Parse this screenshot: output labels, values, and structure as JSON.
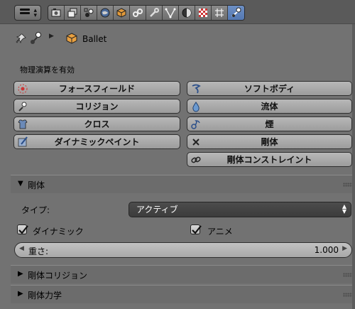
{
  "header": {
    "tabs": [
      {
        "icon": "render-icon",
        "active": false
      },
      {
        "icon": "render-layers-icon",
        "active": false
      },
      {
        "icon": "scene-icon",
        "active": false
      },
      {
        "icon": "world-icon",
        "active": false
      },
      {
        "icon": "object-icon",
        "active": false
      },
      {
        "icon": "constraints-icon",
        "active": false
      },
      {
        "icon": "modifiers-icon",
        "active": false
      },
      {
        "icon": "data-icon",
        "active": false
      },
      {
        "icon": "material-icon",
        "active": false
      },
      {
        "icon": "texture-icon",
        "active": false
      },
      {
        "icon": "particles-icon",
        "active": false
      },
      {
        "icon": "physics-icon",
        "active": true
      }
    ]
  },
  "context": {
    "object_name": "Ballet"
  },
  "enable_physics": {
    "label": "物理演算を有効",
    "buttons": {
      "force_field": "フォースフィールド",
      "collision": "コリジョン",
      "cloth": "クロス",
      "dynamic_paint": "ダイナミックペイント",
      "soft_body": "ソフトボディ",
      "fluid": "流体",
      "smoke": "煙",
      "rigid_body": "剛体",
      "rigid_body_constraint": "剛体コンストレイント"
    }
  },
  "rigid_body_panel": {
    "title": "剛体",
    "expanded": true,
    "type_label": "タイプ:",
    "type_value": "アクティブ",
    "dynamic_label": "ダイナミック",
    "dynamic_checked": true,
    "animated_label": "アニメ",
    "animated_checked": true,
    "mass_label": "重さ:",
    "mass_value": "1.000"
  },
  "collapsed_panels": {
    "collisions": "剛体コリジョン",
    "dynamics": "剛体力学"
  },
  "colors": {
    "active_tab": "#5478b2",
    "panel_bg": "#727272",
    "dropdown_bg": "#404040"
  }
}
